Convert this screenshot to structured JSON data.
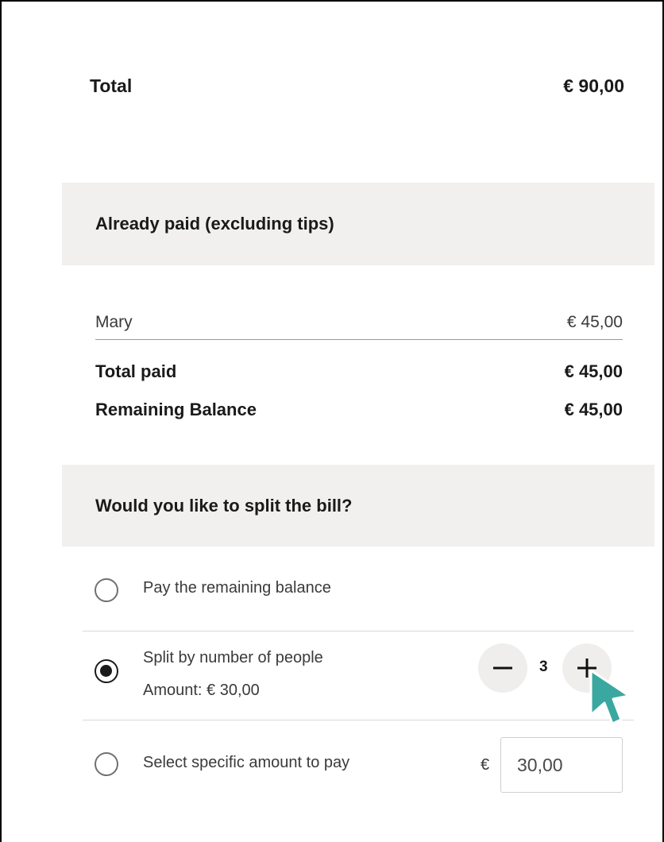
{
  "total": {
    "label": "Total",
    "amount": "€ 90,00"
  },
  "already_paid": {
    "header": "Already paid (excluding tips)",
    "payments": [
      {
        "name": "Mary",
        "amount": "€ 45,00"
      }
    ],
    "total_paid_label": "Total paid",
    "total_paid_amount": "€ 45,00",
    "remaining_label": "Remaining Balance",
    "remaining_amount": "€ 45,00"
  },
  "split": {
    "header": "Would you like to split the bill?",
    "options": [
      {
        "label": "Pay the remaining balance",
        "selected": false
      },
      {
        "label": "Split by number of people",
        "sub": "Amount: € 30,00",
        "selected": true
      },
      {
        "label": "Select specific amount to pay",
        "selected": false
      }
    ],
    "people_count": "3",
    "currency_symbol": "€",
    "specific_amount_value": "30,00"
  },
  "icons": {
    "minus": "minus-icon",
    "plus": "plus-icon",
    "cursor": "pointer-cursor-icon"
  },
  "colors": {
    "header_bg": "#f1f0ef",
    "stepper_bg": "#efeeed",
    "cursor": "#3aa8a0"
  }
}
